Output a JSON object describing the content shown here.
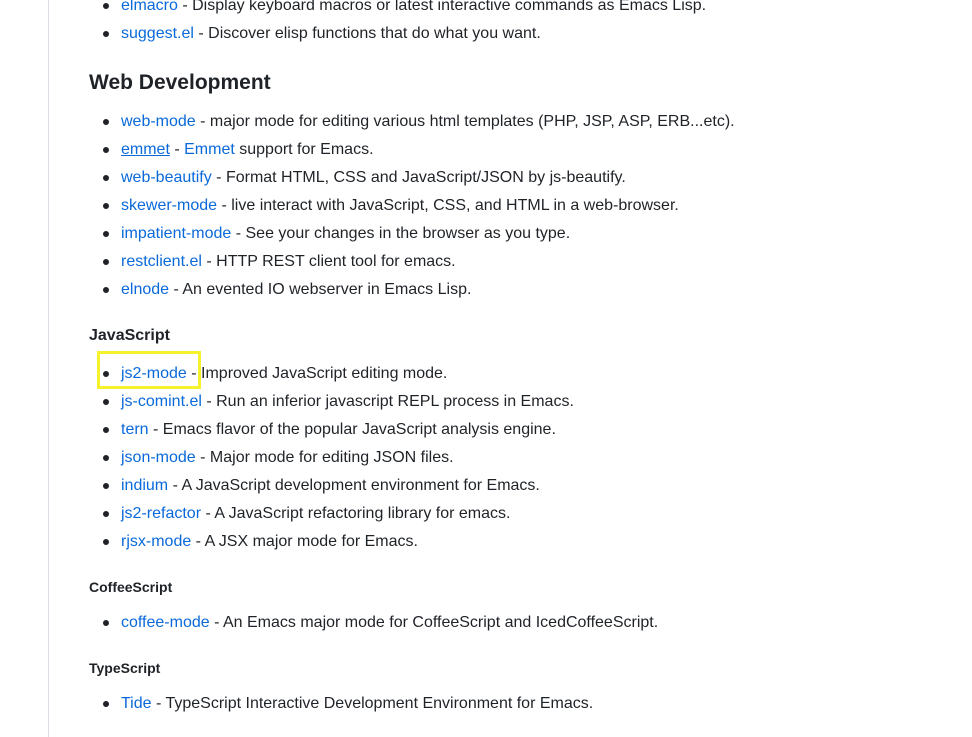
{
  "top_list": [
    {
      "link": "elmacro",
      "desc": " - Display keyboard macros or latest interactive commands as Emacs Lisp."
    },
    {
      "link": "suggest.el",
      "desc": " - Discover elisp functions that do what you want."
    }
  ],
  "web_dev": {
    "heading": "Web Development",
    "items": [
      {
        "link": "web-mode",
        "desc": " - major mode for editing various html templates (PHP, JSP, ASP, ERB...etc)."
      },
      {
        "link": "emmet",
        "sep": " - ",
        "link2": "Emmet",
        "desc": " support for Emacs."
      },
      {
        "link": "web-beautify",
        "desc": " - Format HTML, CSS and JavaScript/JSON by js-beautify."
      },
      {
        "link": "skewer-mode",
        "desc": " - live interact with JavaScript, CSS, and HTML in a web-browser."
      },
      {
        "link": "impatient-mode",
        "desc": " - See your changes in the browser as you type."
      },
      {
        "link": "restclient.el",
        "desc": " - HTTP REST client tool for emacs."
      },
      {
        "link": "elnode",
        "desc": " - An evented IO webserver in Emacs Lisp."
      }
    ]
  },
  "javascript": {
    "heading": "JavaScript",
    "items": [
      {
        "link": "js2-mode",
        "desc": " - Improved JavaScript editing mode."
      },
      {
        "link": "js-comint.el",
        "desc": " - Run an inferior javascript REPL process in Emacs."
      },
      {
        "link": "tern",
        "desc": " - Emacs flavor of the popular JavaScript analysis engine."
      },
      {
        "link": "json-mode",
        "desc": " - Major mode for editing JSON files."
      },
      {
        "link": "indium",
        "desc": " - A JavaScript development environment for Emacs."
      },
      {
        "link": "js2-refactor",
        "desc": " - A JavaScript refactoring library for emacs."
      },
      {
        "link": "rjsx-mode",
        "desc": " - A JSX major mode for Emacs."
      }
    ]
  },
  "coffeescript": {
    "heading": "CoffeeScript",
    "items": [
      {
        "link": "coffee-mode",
        "desc": " - An Emacs major mode for CoffeeScript and IcedCoffeeScript."
      }
    ]
  },
  "typescript": {
    "heading": "TypeScript",
    "items": [
      {
        "link": "Tide",
        "desc": " - TypeScript Interactive Development Environment for Emacs."
      }
    ]
  },
  "colors": {
    "link": "#0969da",
    "text": "#1f2328",
    "highlight_box": "#f5f22b"
  }
}
